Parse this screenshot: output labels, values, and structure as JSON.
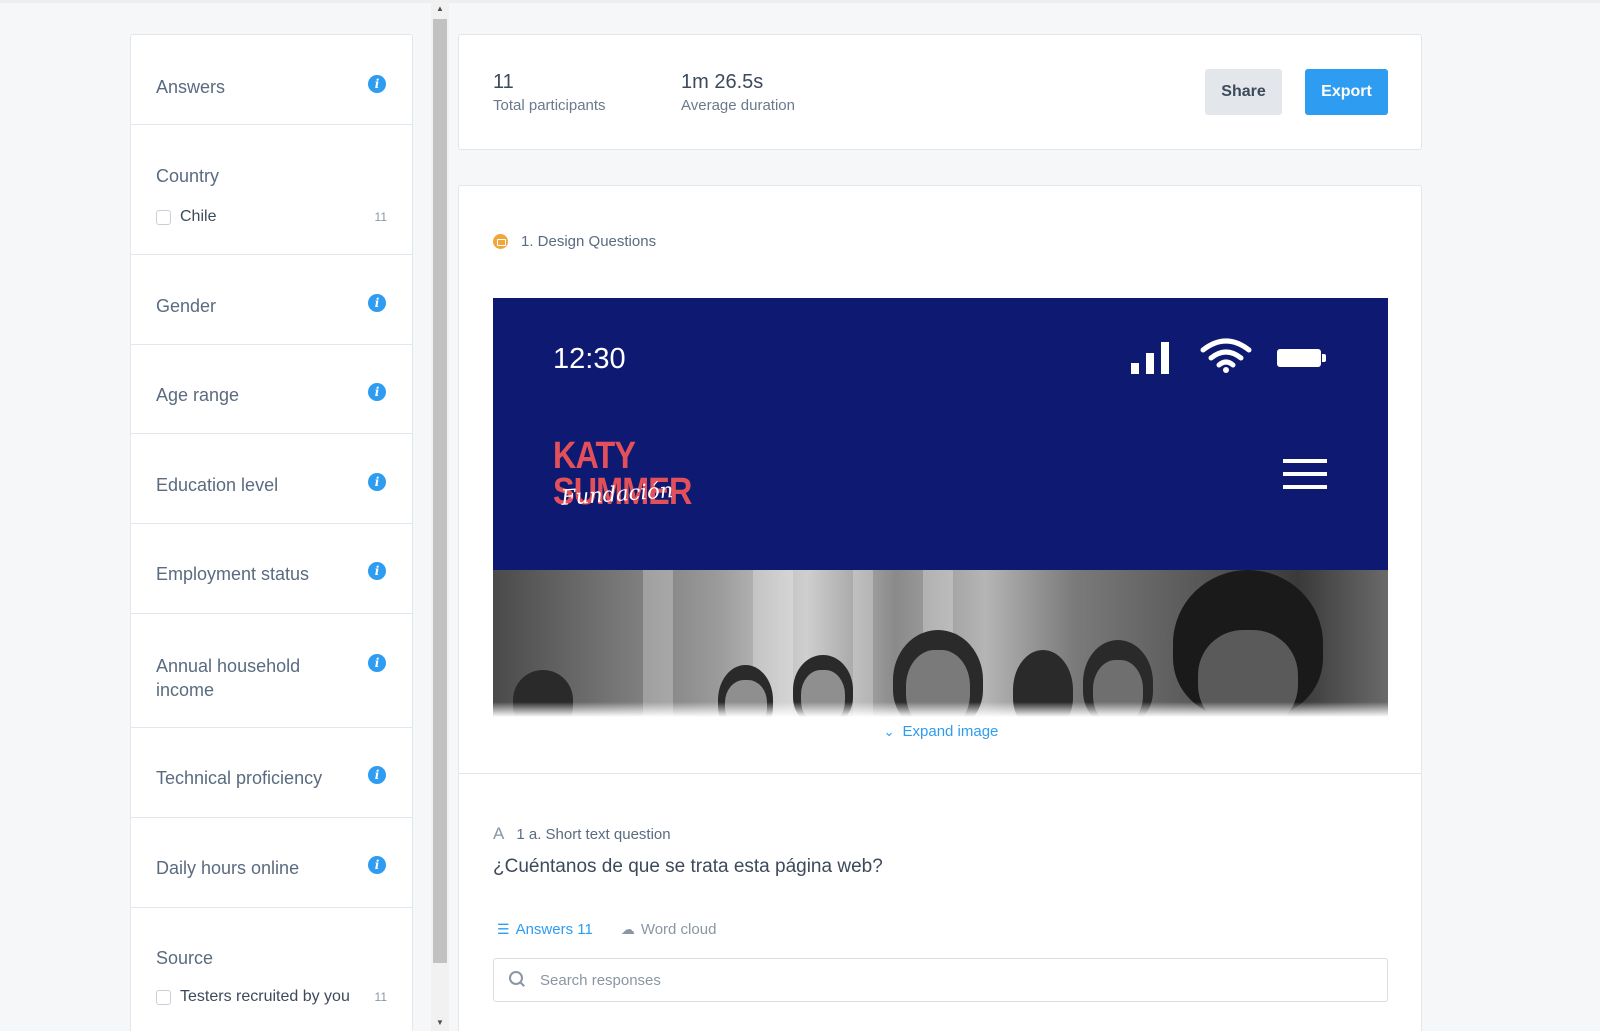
{
  "sidebar": {
    "filters": [
      {
        "name": "Answers",
        "info": true
      },
      {
        "name": "Country",
        "info": false,
        "options": [
          {
            "label": "Chile",
            "count": "11",
            "checked": false
          }
        ]
      },
      {
        "name": "Gender",
        "info": true
      },
      {
        "name": "Age range",
        "info": true
      },
      {
        "name": "Education level",
        "info": true
      },
      {
        "name": "Employment status",
        "info": true
      },
      {
        "name": "Annual household income",
        "info": true
      },
      {
        "name": "Technical proficiency",
        "info": true
      },
      {
        "name": "Daily hours online",
        "info": true
      },
      {
        "name": "Source",
        "info": false,
        "options": [
          {
            "label": "Testers recruited by you",
            "count": "11",
            "checked": false
          }
        ]
      }
    ]
  },
  "stats": {
    "participants_value": "11",
    "participants_label": "Total participants",
    "duration_value": "1m 26.5s",
    "duration_label": "Average duration"
  },
  "actions": {
    "share_label": "Share",
    "export_label": "Export"
  },
  "section": {
    "title": "1. Design Questions",
    "mock": {
      "time": "12:30",
      "logo_line1": "KATY",
      "logo_line2": "SUMMER",
      "logo_script": "Fundación"
    },
    "expand_label": "Expand image"
  },
  "question": {
    "type_label": "1 a. Short text question",
    "text": "¿Cuéntanos de que se trata esta página web?",
    "tab_answers": "Answers 11",
    "tab_wordcloud": "Word cloud",
    "search_placeholder": "Search responses",
    "search_value": ""
  },
  "colors": {
    "accent": "#2e9cf0",
    "mock_bg": "#0e1a72",
    "logo": "#e4505a",
    "section_icon": "#f0a63a"
  }
}
